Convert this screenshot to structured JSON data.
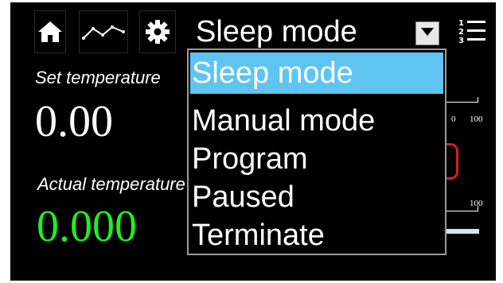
{
  "toolbar": {
    "icons": [
      "home-icon",
      "trend-chart-icon",
      "gear-icon",
      "numbered-list-icon"
    ]
  },
  "mode_select": {
    "value": "Sleep mode",
    "options": [
      "Sleep mode",
      "Manual mode",
      "Program",
      "Paused",
      "Terminate"
    ]
  },
  "set_temperature": {
    "label": "Set temperature",
    "value": "0.00"
  },
  "actual_temperature": {
    "label": "Actual temperature",
    "value": "0.000"
  },
  "gauges": {
    "upper_max_label": "100",
    "upper_min_fragment": "0",
    "lower_max_label": "100"
  },
  "colors": {
    "background": "#000000",
    "selected_option": "#5fc4f2",
    "actual_value": "#22ee22",
    "set_value": "#ffffff",
    "indicator_red": "#d62020",
    "indicator_blue": "#cfe8ff"
  }
}
